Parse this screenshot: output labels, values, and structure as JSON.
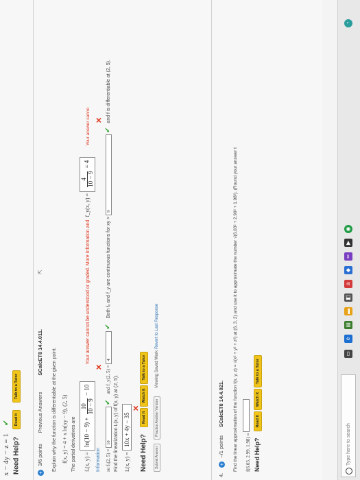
{
  "header": {
    "equation_top": "x − 4y − z = 1",
    "need_help": "Need Help?",
    "read_it": "Read It",
    "talk_to_tutor": "Talk to a Tutor"
  },
  "q3": {
    "points": "3/6 points",
    "previous_answers": "Previous Answers",
    "code": "SCalcET8 14.4.011.",
    "instruction": "Explain why the function is differentiable at the given point.",
    "function": "f(x, y) = 4 + x ln(xy − 9),   (2, 5)",
    "partials_label": "The partial derivatives are",
    "fx_lhs": "fₓ(x, y) =",
    "fx_answer": "ln(10 − 9) +",
    "fx_frac_num": "10",
    "fx_frac_den": "10 − 9",
    "fx_tail": "− 10",
    "feedback": "Your answer cannot be understood or graded. More Information and",
    "fy_lhs": "f_y(x, y) =",
    "fy_frac_num": "4",
    "fy_frac_den": "10 − 9",
    "fy_tail": "= 4",
    "cut_feedback": "Your answer canno",
    "info": "Information",
    "fx25_lhs": "so fₓ(2, 5) =",
    "fx25_val": "10",
    "fy25_lhs": "and f_y(2, 5) =",
    "fy25_val": "4",
    "both_text": "Both fₓ and f_y are continuous functions for xy >",
    "xy_val": "9",
    "diff_text": "and f is differentiable at (2, 5).",
    "linearization_label": "Find the linearization L(x, y) of f(x, y) at (2, 5).",
    "L_lhs": "L(x, y) =",
    "L_answer": "10x + 4y − 35",
    "need_help": "Need Help?",
    "read_it": "Read It",
    "watch_it": "Watch It",
    "talk_to_tutor": "Talk to a Tutor",
    "submit_answer": "Submit Answer",
    "practice": "Practice Another Version",
    "viewing_saved": "Viewing Saved Work",
    "revert": "Revert to Last Response"
  },
  "q4": {
    "number": "4.",
    "points": "–/1 points",
    "code": "SCalcET8 14.4.021.",
    "line1": "Find the linear approximation of the function f(x, y, z) = √(x² + y² + z²) at (6, 3, 2) and use it to approximate the number √(6.03² + 2.99² + 1.98²). (Round your answer t",
    "approx_lhs": "f(6.03, 2.99, 1.98) ≈",
    "need_help": "Need Help?",
    "read_it": "Read It",
    "watch_it": "Watch It",
    "talk_to_tutor": "Talk to a Tutor"
  },
  "taskbar": {
    "search_placeholder": "Type here to search"
  }
}
